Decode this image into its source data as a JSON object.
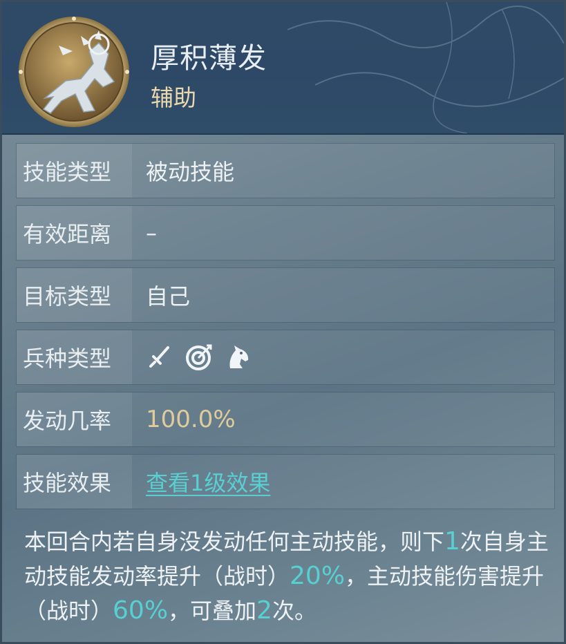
{
  "skill": {
    "name": "厚积薄发",
    "role": "辅助",
    "emblem_icon": "horse-emblem-icon"
  },
  "rows": [
    {
      "label": "技能类型",
      "value": "被动技能"
    },
    {
      "label": "有效距离",
      "value": "–"
    },
    {
      "label": "目标类型",
      "value": "自己"
    },
    {
      "label": "兵种类型",
      "icons": [
        "sword-icon",
        "target-bow-icon",
        "horse-head-icon"
      ]
    },
    {
      "label": "发动几率",
      "value": "100.0%"
    },
    {
      "label": "技能效果",
      "value": "查看1级效果"
    }
  ],
  "description": {
    "part1": "本回合内若自身没发动任何主动技能，则下",
    "n1": "1",
    "part2": "次自身主动技能发动率提升（战时）",
    "n2": "20%",
    "part3": "，主动技能伤害提升（战时）",
    "n3": "60%",
    "part4": "，可叠加",
    "n4": "2",
    "part5": "次。"
  },
  "colors": {
    "header_bg": "#2f4a66",
    "gold_text": "#e0cc9a",
    "highlight": "#58d0d2",
    "role_text": "#e9d9ad"
  }
}
